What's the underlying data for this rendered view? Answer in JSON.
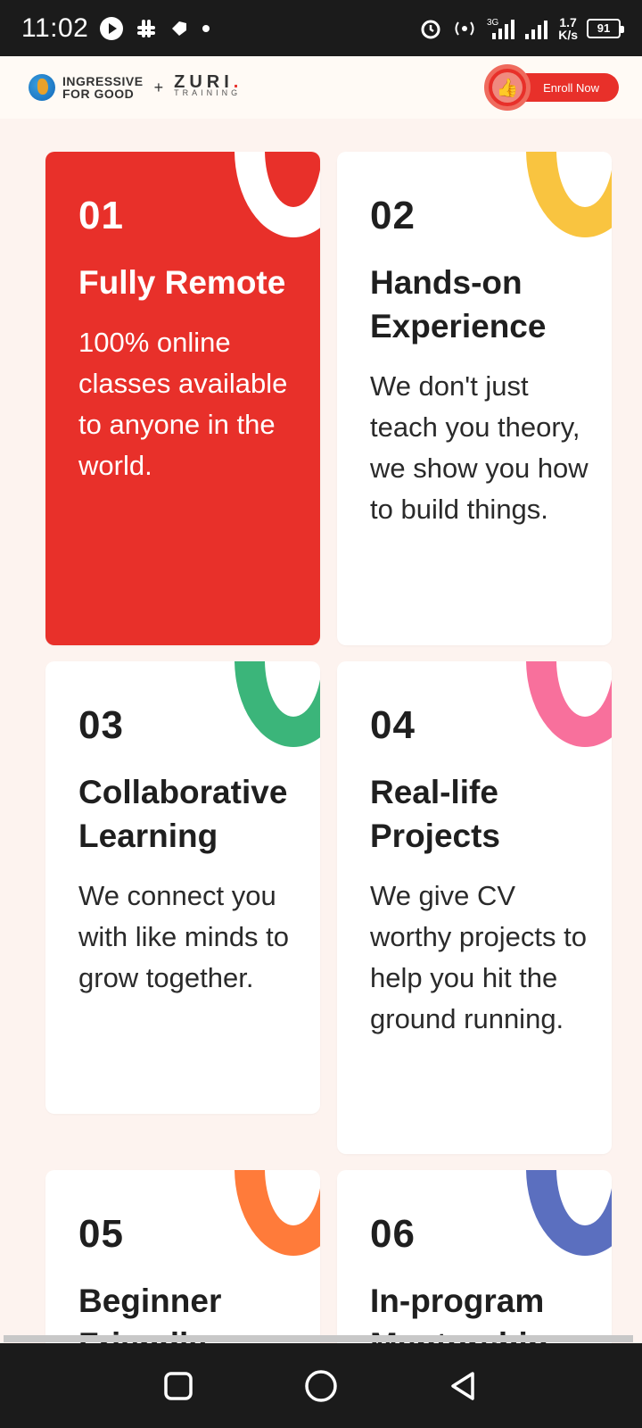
{
  "status_bar": {
    "time": "11:02",
    "net_speed_top": "1.7",
    "net_speed_bottom": "K/s",
    "battery": "91",
    "signal_label": "3G"
  },
  "header": {
    "brand_line1": "INGRESSIVE",
    "brand_line2": "FOR GOOD",
    "plus": "+",
    "zuri_name": "ZURI",
    "zuri_dot": ".",
    "zuri_sub": "TRAINING",
    "enroll_label": "Enroll Now",
    "thumb_icon": "👍"
  },
  "cards": [
    {
      "num": "01",
      "title": "Fully Remote",
      "desc": "100% online classes available to anyone in the world.",
      "accent": "#ffffff"
    },
    {
      "num": "02",
      "title": "Hands-on Experience",
      "desc": "We don't just teach you theory, we show you how to build things.",
      "accent": "#f9c440"
    },
    {
      "num": "03",
      "title": "Collaborative Learning",
      "desc": "We connect you with like minds to grow together.",
      "accent": "#3bb57a"
    },
    {
      "num": "04",
      "title": "Real-life Projects",
      "desc": "We give CV worthy projects to help you hit the ground running.",
      "accent": "#f8709c"
    },
    {
      "num": "05",
      "title": "Beginner Friendly",
      "desc": "",
      "accent": "#ff7b3a"
    },
    {
      "num": "06",
      "title": "In-program Mentorship",
      "desc": "",
      "accent": "#5b6fbf"
    }
  ],
  "colors": {
    "primary_red": "#e8302a",
    "page_bg": "#fdf3ef"
  }
}
